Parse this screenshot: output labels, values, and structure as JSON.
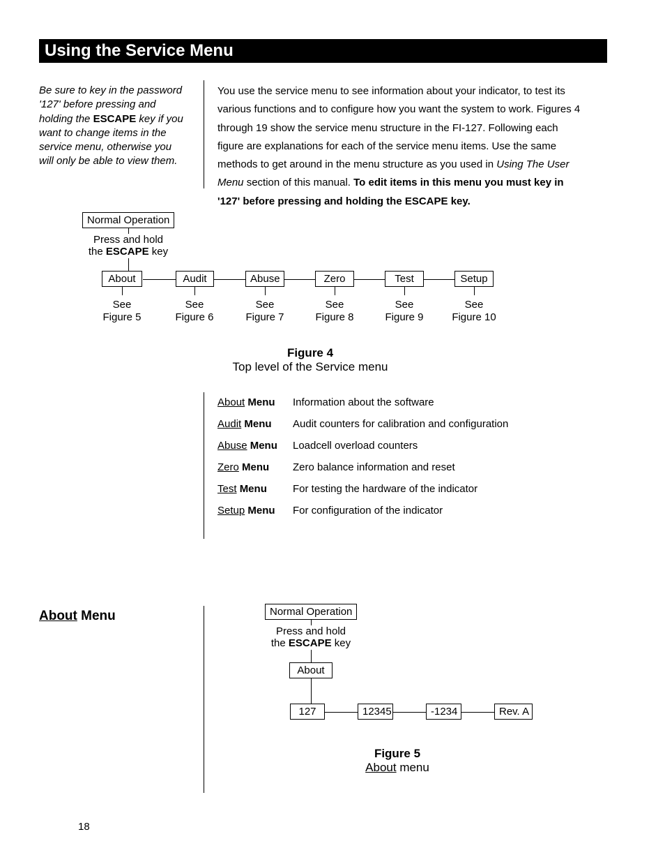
{
  "title_bar": "Using the Service Menu",
  "sidebar": {
    "line1": "Be sure to key in the password '127' before pressing and holding the ",
    "escape": "ESCAPE",
    "line2": " key if you want to change items in the service menu, otherwise you will only be able to view them."
  },
  "main": {
    "p1a": "You use the service menu to see information about your indicator, to test its various functions and to configure how you want the system to work. Figures 4 through 19 show the service menu structure in the FI-127. Following each figure are explanations for each of the service menu items. Use the same methods to get around in the menu structure as you used in ",
    "p1b": "Using The User Menu",
    "p1c": " section of this manual. ",
    "p1d": "To edit items in this menu you must key in '127' before pressing and holding the ESCAPE key."
  },
  "diagram4": {
    "normal_op": "Normal Operation",
    "press1": "Press and hold",
    "press2a": "the ",
    "press2b": "ESCAPE",
    "press2c": " key",
    "nodes": [
      "About",
      "Audit",
      "Abuse",
      "Zero",
      "Test",
      "Setup"
    ],
    "see": "See",
    "figs": [
      "Figure 5",
      "Figure 6",
      "Figure 7",
      "Figure 8",
      "Figure 9",
      "Figure 10"
    ]
  },
  "fig4": {
    "title": "Figure 4",
    "caption": "Top level of the Service menu"
  },
  "legend": [
    {
      "key_u": "About",
      "key_b": "Menu",
      "desc": "Information about the software"
    },
    {
      "key_u": "Audit",
      "key_b": "Menu",
      "desc": "Audit counters for calibration and configuration"
    },
    {
      "key_u": "Abuse",
      "key_b": "Menu",
      "desc": "Loadcell overload counters"
    },
    {
      "key_u": "Zero",
      "key_b": "Menu",
      "desc": "Zero balance information and reset"
    },
    {
      "key_u": "Test",
      "key_b": "Menu",
      "desc": "For testing the hardware of the indicator"
    },
    {
      "key_u": "Setup",
      "key_b": "Menu",
      "desc": "For configuration of the indicator"
    }
  ],
  "about_head": {
    "u": "About",
    "rest": " Menu"
  },
  "diagram5": {
    "normal_op": "Normal Operation",
    "press1": "Press and hold",
    "press2a": "the ",
    "press2b": "ESCAPE",
    "press2c": " key",
    "about": "About",
    "leaves": [
      "127",
      "12345",
      "-1234",
      "Rev. A"
    ]
  },
  "fig5": {
    "title": "Figure 5",
    "caption_u": "About",
    "caption_rest": " menu"
  },
  "page_number": "18"
}
